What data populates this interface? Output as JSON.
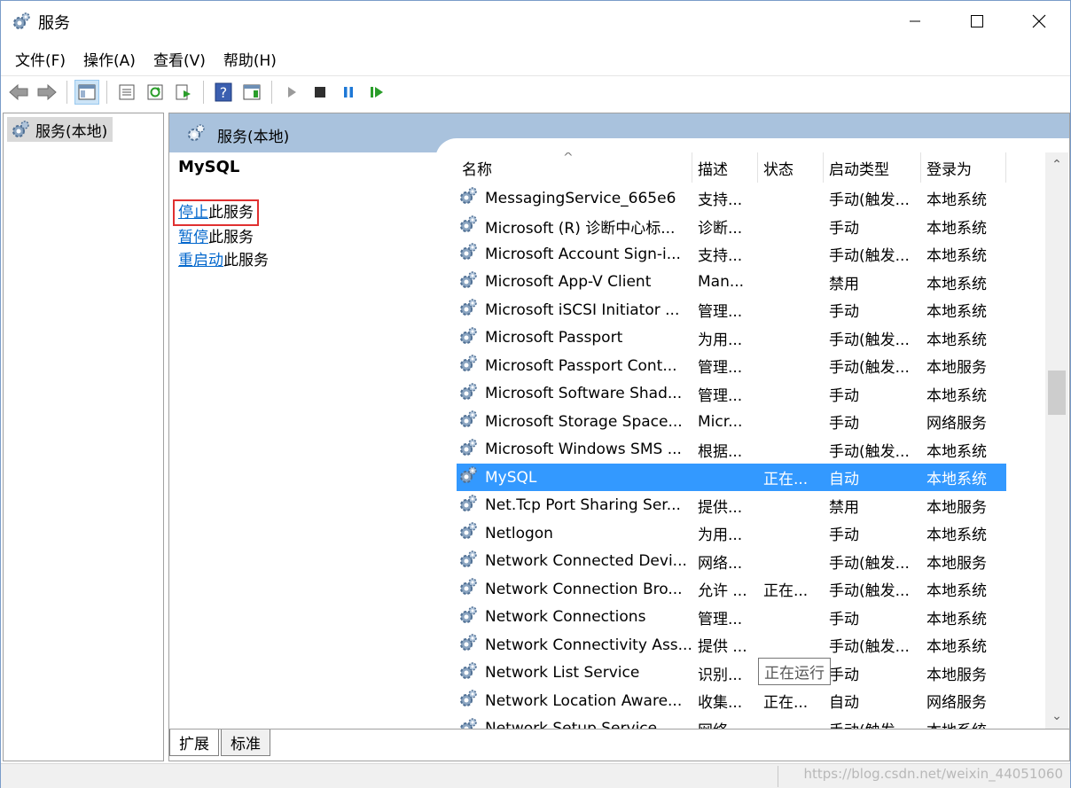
{
  "window": {
    "title": "服务"
  },
  "menu": [
    "文件(F)",
    "操作(A)",
    "查看(V)",
    "帮助(H)"
  ],
  "tree": {
    "root": "服务(本地)"
  },
  "pane": {
    "header": "服务(本地)"
  },
  "detail": {
    "service_name": "MySQL",
    "stop_link": "停止",
    "stop_rest": "此服务",
    "pause_link": "暂停",
    "pause_rest": "此服务",
    "restart_link": "重启动",
    "restart_rest": "此服务"
  },
  "columns": {
    "name": "名称",
    "desc": "描述",
    "status": "状态",
    "startup": "启动类型",
    "logon": "登录为"
  },
  "rows": [
    {
      "name": "MessagingService_665e6",
      "desc": "支持...",
      "status": "",
      "startup": "手动(触发...",
      "logon": "本地系统"
    },
    {
      "name": "Microsoft (R) 诊断中心标...",
      "desc": "诊断...",
      "status": "",
      "startup": "手动",
      "logon": "本地系统"
    },
    {
      "name": "Microsoft Account Sign-i...",
      "desc": "支持...",
      "status": "",
      "startup": "手动(触发...",
      "logon": "本地系统"
    },
    {
      "name": "Microsoft App-V Client",
      "desc": "Man...",
      "status": "",
      "startup": "禁用",
      "logon": "本地系统"
    },
    {
      "name": "Microsoft iSCSI Initiator ...",
      "desc": "管理...",
      "status": "",
      "startup": "手动",
      "logon": "本地系统"
    },
    {
      "name": "Microsoft Passport",
      "desc": "为用...",
      "status": "",
      "startup": "手动(触发...",
      "logon": "本地系统"
    },
    {
      "name": "Microsoft Passport Cont...",
      "desc": "管理...",
      "status": "",
      "startup": "手动(触发...",
      "logon": "本地服务"
    },
    {
      "name": "Microsoft Software Shad...",
      "desc": "管理...",
      "status": "",
      "startup": "手动",
      "logon": "本地系统"
    },
    {
      "name": "Microsoft Storage Space...",
      "desc": "Micr...",
      "status": "",
      "startup": "手动",
      "logon": "网络服务"
    },
    {
      "name": "Microsoft Windows SMS ...",
      "desc": "根据...",
      "status": "",
      "startup": "手动(触发...",
      "logon": "本地系统"
    },
    {
      "name": "MySQL",
      "desc": "",
      "status": "正在...",
      "startup": "自动",
      "logon": "本地系统",
      "selected": true
    },
    {
      "name": "Net.Tcp Port Sharing Ser...",
      "desc": "提供...",
      "status": "",
      "startup": "禁用",
      "logon": "本地服务"
    },
    {
      "name": "Netlogon",
      "desc": "为用...",
      "status": "",
      "startup": "手动",
      "logon": "本地系统"
    },
    {
      "name": "Network Connected Devi...",
      "desc": "网络...",
      "status": "",
      "startup": "手动(触发...",
      "logon": "本地服务"
    },
    {
      "name": "Network Connection Bro...",
      "desc": "允许 ...",
      "status": "正在...",
      "startup": "手动(触发...",
      "logon": "本地系统"
    },
    {
      "name": "Network Connections",
      "desc": "管理...",
      "status": "",
      "startup": "手动",
      "logon": "本地系统"
    },
    {
      "name": "Network Connectivity Ass...",
      "desc": "提供 ...",
      "status": "",
      "startup": "手动(触发...",
      "logon": "本地系统"
    },
    {
      "name": "Network List Service",
      "desc": "识别...",
      "status": "",
      "startup": "手动",
      "logon": "本地服务"
    },
    {
      "name": "Network Location Aware...",
      "desc": "收集...",
      "status": "正在...",
      "startup": "自动",
      "logon": "网络服务"
    },
    {
      "name": "Network Setup Service",
      "desc": "网络...",
      "status": "",
      "startup": "手动(触发...",
      "logon": "本地系统"
    }
  ],
  "tooltip": "正在运行",
  "tabs": [
    "扩展",
    "标准"
  ],
  "watermark": "https://blog.csdn.net/weixin_44051060",
  "colors": {
    "selection": "#3399ff",
    "pane_header": "#a9c2dd",
    "link": "#0066cc",
    "highlight_box": "#e03030"
  }
}
